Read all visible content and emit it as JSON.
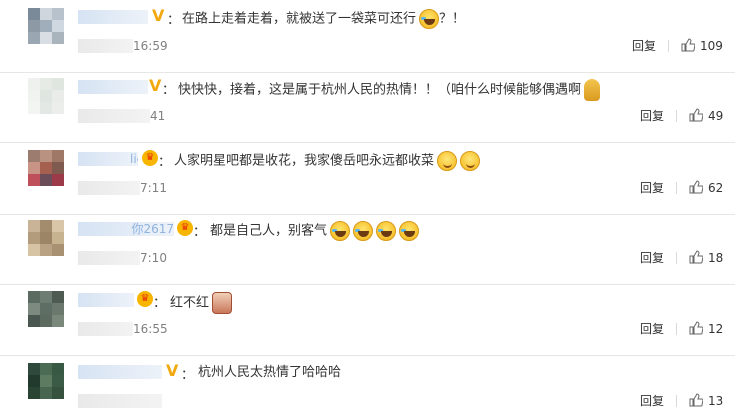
{
  "comments": [
    {
      "name": "",
      "badge": "v",
      "text": "在路上走着走着，就被送了一袋菜可还行",
      "emojis": [
        "laugh"
      ],
      "suffix": "？！",
      "time": "16:59",
      "reply": "回复",
      "likes": "109",
      "avatar": [
        "#7a8a98",
        "#cfd6dd",
        "#b8c2cc",
        "#8d9aa6",
        "#a0adba",
        "#cfd8e0",
        "#9aa7b3",
        "#d8dee3",
        "#aab4bd"
      ]
    },
    {
      "name": "",
      "badge": "v",
      "text": "快快快，接着，这是属于杭州人民的热情！！（咱什么时候能够偶遇啊",
      "emojis": [
        "pray"
      ],
      "suffix": "",
      "time": "41",
      "reply": "回复",
      "likes": "49",
      "avatar": [
        "#eef1ee",
        "#e7ebe6",
        "#dfe5df",
        "#f1f3f1",
        "#dfe6df",
        "#e9ece9",
        "#f3f5f3",
        "#e4e8e4",
        "#eceeec"
      ]
    },
    {
      "name": "lie",
      "badge": "crown",
      "text": "人家明星吧都是收花，我家傻岳吧永远都收菜",
      "emojis": [
        "smile",
        "smile"
      ],
      "suffix": "",
      "time": "7:11",
      "reply": "回复",
      "likes": "62",
      "avatar": [
        "#9b7c6e",
        "#b99282",
        "#a07868",
        "#c79486",
        "#a5604f",
        "#7f5a4e",
        "#c04f5c",
        "#6b4d5a",
        "#9c3a49"
      ]
    },
    {
      "name": "你2617",
      "badge": "crown",
      "text": "都是自己人，别客气",
      "emojis": [
        "laugh",
        "laugh",
        "laugh",
        "laugh"
      ],
      "suffix": "",
      "time": "7:10",
      "reply": "回复",
      "likes": "18",
      "avatar": [
        "#c9b497",
        "#a38b6e",
        "#d9c6a9",
        "#b29c7c",
        "#9c8466",
        "#c8b391",
        "#d6c4a4",
        "#b8a283",
        "#a89072"
      ]
    },
    {
      "name": "",
      "badge": "crown",
      "text": "红不红",
      "emojis": [
        "face"
      ],
      "suffix": "",
      "time": "16:55",
      "reply": "回复",
      "likes": "12",
      "avatar": [
        "#5b6b61",
        "#6e7d72",
        "#4d5b52",
        "#7c8a7f",
        "#5f6e64",
        "#6a786e",
        "#4a5750",
        "#5c6a60",
        "#7a887c"
      ]
    },
    {
      "name": "",
      "badge": "v",
      "text": "杭州人民太热情了哈哈哈",
      "emojis": [],
      "suffix": "",
      "time": "",
      "reply": "回复",
      "likes": "13",
      "avatar": [
        "#2f4a3c",
        "#4c6b54",
        "#385a45",
        "#22392d",
        "#5d7b60",
        "#3b5b46",
        "#2a4434",
        "#48664f",
        "#36523f"
      ]
    }
  ]
}
